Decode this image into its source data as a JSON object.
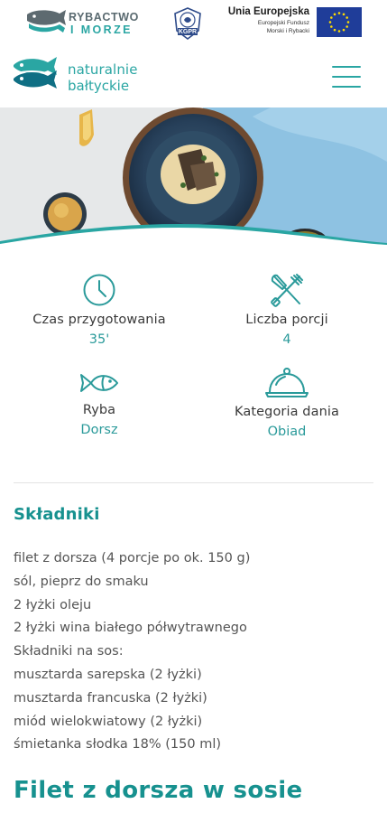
{
  "header": {
    "logo_rybactwo_line1": "RYBACTWO",
    "logo_rybactwo_line2": "I MORZE",
    "logo_kgpr": "KGPR",
    "ue_title": "Unia Europejska",
    "ue_sub1": "Europejski Fundusz",
    "ue_sub2": "Morski i Rybacki",
    "site_logo_line1": "naturalnie",
    "site_logo_line2": "bałtyckie",
    "icons": [
      "rybactwo-fish-logo-icon",
      "kgpr-emblem-icon",
      "eu-flag-icon",
      "naturalnie-fish-logo-icon",
      "hamburger-menu-icon"
    ]
  },
  "info": {
    "prep_time_label": "Czas przygotowania",
    "prep_time_value": "35'",
    "servings_label": "Liczba porcji",
    "servings_value": "4",
    "fish_label": "Ryba",
    "fish_value": "Dorsz",
    "category_label": "Kategoria dania",
    "category_value": "Obiad",
    "icons": [
      "clock-icon",
      "fork-knife-icon",
      "fish-icon",
      "cloche-icon"
    ]
  },
  "ingredients": {
    "title": "Składniki",
    "items": [
      "filet z dorsza (4 porcje po ok. 150 g)",
      "sól, pieprz do smaku",
      "2 łyżki oleju",
      "2 łyżki wina białego półwytrawnego",
      "Składniki na sos:",
      "musztarda sarepska (2 łyżki)",
      "musztarda francuska (2 łyżki)",
      "miód wielokwiatowy (2 łyżki)",
      "śmietanka słodka 18% (150 ml)"
    ]
  },
  "recipe_title": "Filet z dorsza w sosie",
  "colors": {
    "accent": "#2aa6a3",
    "accent_dark": "#17918f",
    "eu_blue": "#1f3d99",
    "eu_star": "#ffdd00"
  }
}
